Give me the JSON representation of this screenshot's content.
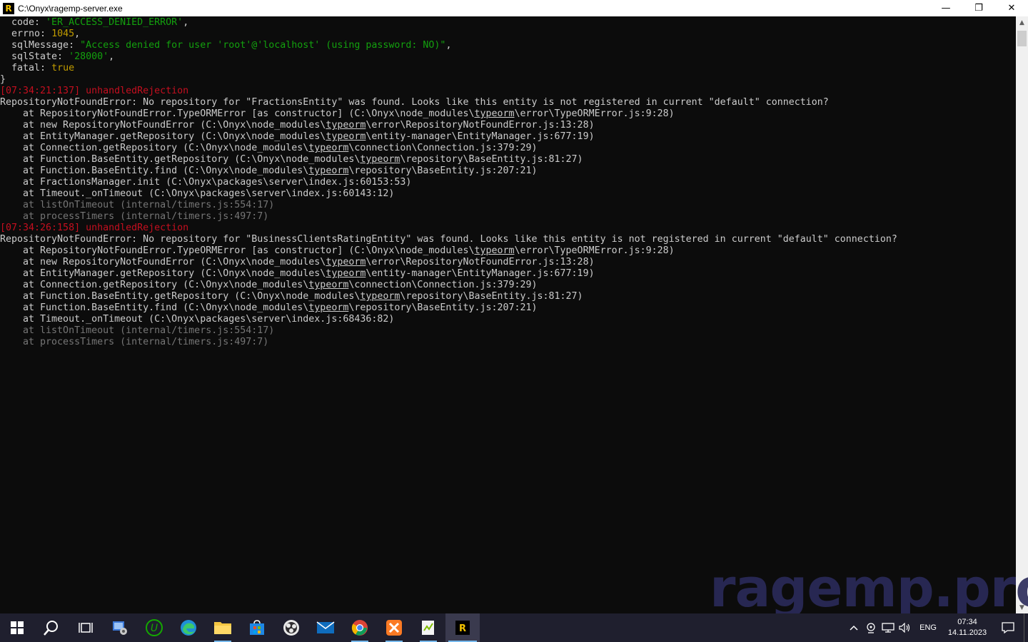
{
  "window": {
    "title": "C:\\Onyx\\ragemp-server.exe",
    "minimize_glyph": "—",
    "maximize_glyph": "❐",
    "close_glyph": "✕"
  },
  "console": {
    "lines": [
      [
        {
          "t": "  code: ",
          "c": ""
        },
        {
          "t": "'ER_ACCESS_DENIED_ERROR'",
          "c": "green"
        },
        {
          "t": ",",
          "c": ""
        }
      ],
      [
        {
          "t": "  errno: ",
          "c": ""
        },
        {
          "t": "1045",
          "c": "yellow"
        },
        {
          "t": ",",
          "c": ""
        }
      ],
      [
        {
          "t": "  sqlMessage: ",
          "c": ""
        },
        {
          "t": "\"Access denied for user 'root'@'localhost' (using password: NO)\"",
          "c": "green"
        },
        {
          "t": ",",
          "c": ""
        }
      ],
      [
        {
          "t": "  sqlState: ",
          "c": ""
        },
        {
          "t": "'28000'",
          "c": "green"
        },
        {
          "t": ",",
          "c": ""
        }
      ],
      [
        {
          "t": "  fatal: ",
          "c": ""
        },
        {
          "t": "true",
          "c": "yellow"
        }
      ],
      [
        {
          "t": "}",
          "c": ""
        }
      ],
      [
        {
          "t": "[07:34:21:137] unhandledRejection",
          "c": "red"
        }
      ],
      [
        {
          "t": "RepositoryNotFoundError: No repository for \"FractionsEntity\" was found. Looks like this entity is not registered in current \"default\" connection?",
          "c": ""
        }
      ],
      [
        {
          "t": "    at RepositoryNotFoundError.TypeORMError [as constructor] (C:\\Onyx\\node_modules\\",
          "c": ""
        },
        {
          "t": "typeorm",
          "c": "ul"
        },
        {
          "t": "\\error\\TypeORMError.js:9:28)",
          "c": ""
        }
      ],
      [
        {
          "t": "    at new RepositoryNotFoundError (C:\\Onyx\\node_modules\\",
          "c": ""
        },
        {
          "t": "typeorm",
          "c": "ul"
        },
        {
          "t": "\\error\\RepositoryNotFoundError.js:13:28)",
          "c": ""
        }
      ],
      [
        {
          "t": "    at EntityManager.getRepository (C:\\Onyx\\node_modules\\",
          "c": ""
        },
        {
          "t": "typeorm",
          "c": "ul"
        },
        {
          "t": "\\entity-manager\\EntityManager.js:677:19)",
          "c": ""
        }
      ],
      [
        {
          "t": "    at Connection.getRepository (C:\\Onyx\\node_modules\\",
          "c": ""
        },
        {
          "t": "typeorm",
          "c": "ul"
        },
        {
          "t": "\\connection\\Connection.js:379:29)",
          "c": ""
        }
      ],
      [
        {
          "t": "    at Function.BaseEntity.getRepository (C:\\Onyx\\node_modules\\",
          "c": ""
        },
        {
          "t": "typeorm",
          "c": "ul"
        },
        {
          "t": "\\repository\\BaseEntity.js:81:27)",
          "c": ""
        }
      ],
      [
        {
          "t": "    at Function.BaseEntity.find (C:\\Onyx\\node_modules\\",
          "c": ""
        },
        {
          "t": "typeorm",
          "c": "ul"
        },
        {
          "t": "\\repository\\BaseEntity.js:207:21)",
          "c": ""
        }
      ],
      [
        {
          "t": "    at FractionsManager.init (C:\\Onyx\\packages\\server\\index.js:60153:53)",
          "c": ""
        }
      ],
      [
        {
          "t": "    at Timeout._onTimeout (C:\\Onyx\\packages\\server\\index.js:60143:12)",
          "c": ""
        }
      ],
      [
        {
          "t": "    at listOnTimeout (internal/timers.js:554:17)",
          "c": "gray"
        }
      ],
      [
        {
          "t": "    at processTimers (internal/timers.js:497:7)",
          "c": "gray"
        }
      ],
      [
        {
          "t": "[07:34:26:158] unhandledRejection",
          "c": "red"
        }
      ],
      [
        {
          "t": "RepositoryNotFoundError: No repository for \"BusinessClientsRatingEntity\" was found. Looks like this entity is not registered in current \"default\" connection?",
          "c": ""
        }
      ],
      [
        {
          "t": "    at RepositoryNotFoundError.TypeORMError [as constructor] (C:\\Onyx\\node_modules\\",
          "c": ""
        },
        {
          "t": "typeorm",
          "c": "ul"
        },
        {
          "t": "\\error\\TypeORMError.js:9:28)",
          "c": ""
        }
      ],
      [
        {
          "t": "    at new RepositoryNotFoundError (C:\\Onyx\\node_modules\\",
          "c": ""
        },
        {
          "t": "typeorm",
          "c": "ul"
        },
        {
          "t": "\\error\\RepositoryNotFoundError.js:13:28)",
          "c": ""
        }
      ],
      [
        {
          "t": "    at EntityManager.getRepository (C:\\Onyx\\node_modules\\",
          "c": ""
        },
        {
          "t": "typeorm",
          "c": "ul"
        },
        {
          "t": "\\entity-manager\\EntityManager.js:677:19)",
          "c": ""
        }
      ],
      [
        {
          "t": "    at Connection.getRepository (C:\\Onyx\\node_modules\\",
          "c": ""
        },
        {
          "t": "typeorm",
          "c": "ul"
        },
        {
          "t": "\\connection\\Connection.js:379:29)",
          "c": ""
        }
      ],
      [
        {
          "t": "    at Function.BaseEntity.getRepository (C:\\Onyx\\node_modules\\",
          "c": ""
        },
        {
          "t": "typeorm",
          "c": "ul"
        },
        {
          "t": "\\repository\\BaseEntity.js:81:27)",
          "c": ""
        }
      ],
      [
        {
          "t": "    at Function.BaseEntity.find (C:\\Onyx\\node_modules\\",
          "c": ""
        },
        {
          "t": "typeorm",
          "c": "ul"
        },
        {
          "t": "\\repository\\BaseEntity.js:207:21)",
          "c": ""
        }
      ],
      [
        {
          "t": "    at Timeout._onTimeout (C:\\Onyx\\packages\\server\\index.js:68436:82)",
          "c": ""
        }
      ],
      [
        {
          "t": "    at listOnTimeout (internal/timers.js:554:17)",
          "c": "gray"
        }
      ],
      [
        {
          "t": "    at processTimers (internal/timers.js:497:7)",
          "c": "gray"
        }
      ]
    ]
  },
  "watermark": "ragemp.pro",
  "taskbar": {
    "apps": [
      {
        "name": "start-button",
        "icon": "windows-logo-icon"
      },
      {
        "name": "search-button",
        "icon": "search-icon"
      },
      {
        "name": "task-view-button",
        "icon": "task-view-icon"
      },
      {
        "name": "app-control-panel",
        "icon": "control-panel-icon"
      },
      {
        "name": "app-upwork",
        "icon": "upwork-icon"
      },
      {
        "name": "app-edge",
        "icon": "edge-icon"
      },
      {
        "name": "app-file-explorer",
        "icon": "folder-icon"
      },
      {
        "name": "app-store",
        "icon": "store-icon"
      },
      {
        "name": "app-obs",
        "icon": "obs-icon"
      },
      {
        "name": "app-mail",
        "icon": "mail-icon"
      },
      {
        "name": "app-chrome",
        "icon": "chrome-icon"
      },
      {
        "name": "app-xampp",
        "icon": "xampp-icon"
      },
      {
        "name": "app-notepad-plus",
        "icon": "notepad-plus-icon"
      },
      {
        "name": "app-ragemp-server",
        "icon": "ragemp-icon"
      }
    ],
    "tray": {
      "language": "ENG",
      "time": "07:34",
      "date": "14.11.2023"
    }
  },
  "colors": {
    "console_bg": "#0c0c0c",
    "console_fg": "#cccccc",
    "green": "#13a10e",
    "yellow": "#c19c00",
    "red": "#c50f1f",
    "gray": "#767676",
    "taskbar_bg": "#1f1f2e"
  }
}
